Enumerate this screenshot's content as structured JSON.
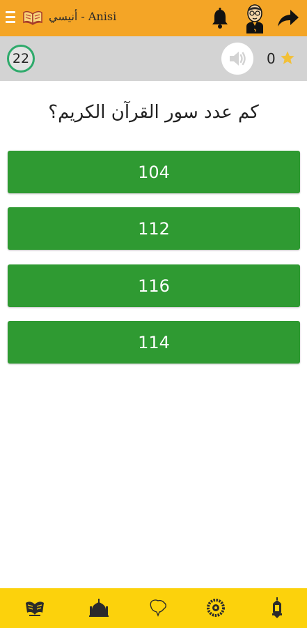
{
  "header": {
    "title": "أنيسي - Anisi",
    "icons": [
      "menu-icon",
      "open-book-logo",
      "bell-icon",
      "avatar",
      "share-icon"
    ],
    "bar_color": "#f4a526"
  },
  "status": {
    "counter": "22",
    "score": "0",
    "icons": [
      "speaker-icon",
      "star-icon"
    ],
    "counter_ring_color": "#2eaa6b",
    "bar_color": "#d3d3d3"
  },
  "question": {
    "text": "كم عدد سور القرآن الكريم؟"
  },
  "answers": [
    "104",
    "112",
    "116",
    "114"
  ],
  "answer_color": "#2f9a32",
  "bottom_nav": {
    "bar_color": "#fcd20c",
    "items": [
      "quran-icon",
      "mosque-icon",
      "map-icon",
      "prayer-beads-icon",
      "lantern-icon"
    ]
  }
}
